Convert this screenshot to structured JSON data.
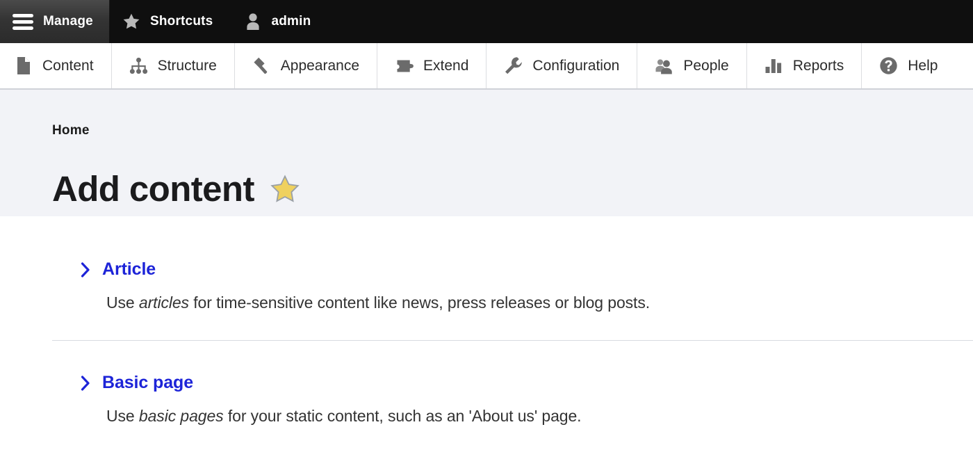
{
  "admin_bar": {
    "items": [
      {
        "label": "Manage",
        "icon": "hamburger-icon",
        "active": true
      },
      {
        "label": "Shortcuts",
        "icon": "star-icon",
        "active": false
      },
      {
        "label": "admin",
        "icon": "user-icon",
        "active": false
      }
    ]
  },
  "menu_bar": {
    "items": [
      {
        "label": "Content",
        "icon": "page-icon"
      },
      {
        "label": "Structure",
        "icon": "sitemap-icon"
      },
      {
        "label": "Appearance",
        "icon": "paintbrush-icon"
      },
      {
        "label": "Extend",
        "icon": "puzzle-piece-icon"
      },
      {
        "label": "Configuration",
        "icon": "wrench-icon"
      },
      {
        "label": "People",
        "icon": "people-icon"
      },
      {
        "label": "Reports",
        "icon": "bar-chart-icon"
      },
      {
        "label": "Help",
        "icon": "question-circle-icon"
      }
    ]
  },
  "page_header": {
    "breadcrumb": "Home",
    "title": "Add content",
    "star_icon": "favorite-star-icon"
  },
  "content_types": [
    {
      "title": "Article",
      "desc_before": "Use ",
      "desc_emphasis": "articles",
      "desc_after": " for time-sensitive content like news, press releases or blog posts."
    },
    {
      "title": "Basic page",
      "desc_before": "Use ",
      "desc_emphasis": "basic pages",
      "desc_after": " for your static content, such as an 'About us' page."
    }
  ],
  "colors": {
    "admin_bar_bg": "#0f0f0f",
    "admin_tab_active_bg": "#3a3a3a",
    "header_bg": "#f2f3f7",
    "link_blue": "#1d24d8",
    "star_gold": "#efd15e",
    "icon_grey": "#6b6b6b",
    "divider": "#d8dae0"
  }
}
